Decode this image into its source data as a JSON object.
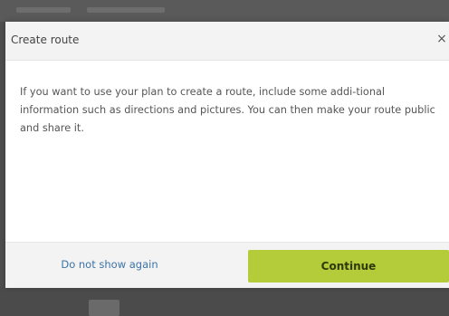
{
  "dialog": {
    "title": "Create route",
    "close_glyph": "×",
    "body_text": "If you want to use your plan to create a route, include some addi-tional information such as directions and pictures. You can then make your route public and share it.",
    "dont_show_label": "Do not show again",
    "continue_label": "Continue"
  },
  "colors": {
    "accent": "#b5cc3a",
    "link": "#3d73a8",
    "backdrop": "#4e4e4e"
  },
  "icons": {
    "close": "close-icon"
  }
}
